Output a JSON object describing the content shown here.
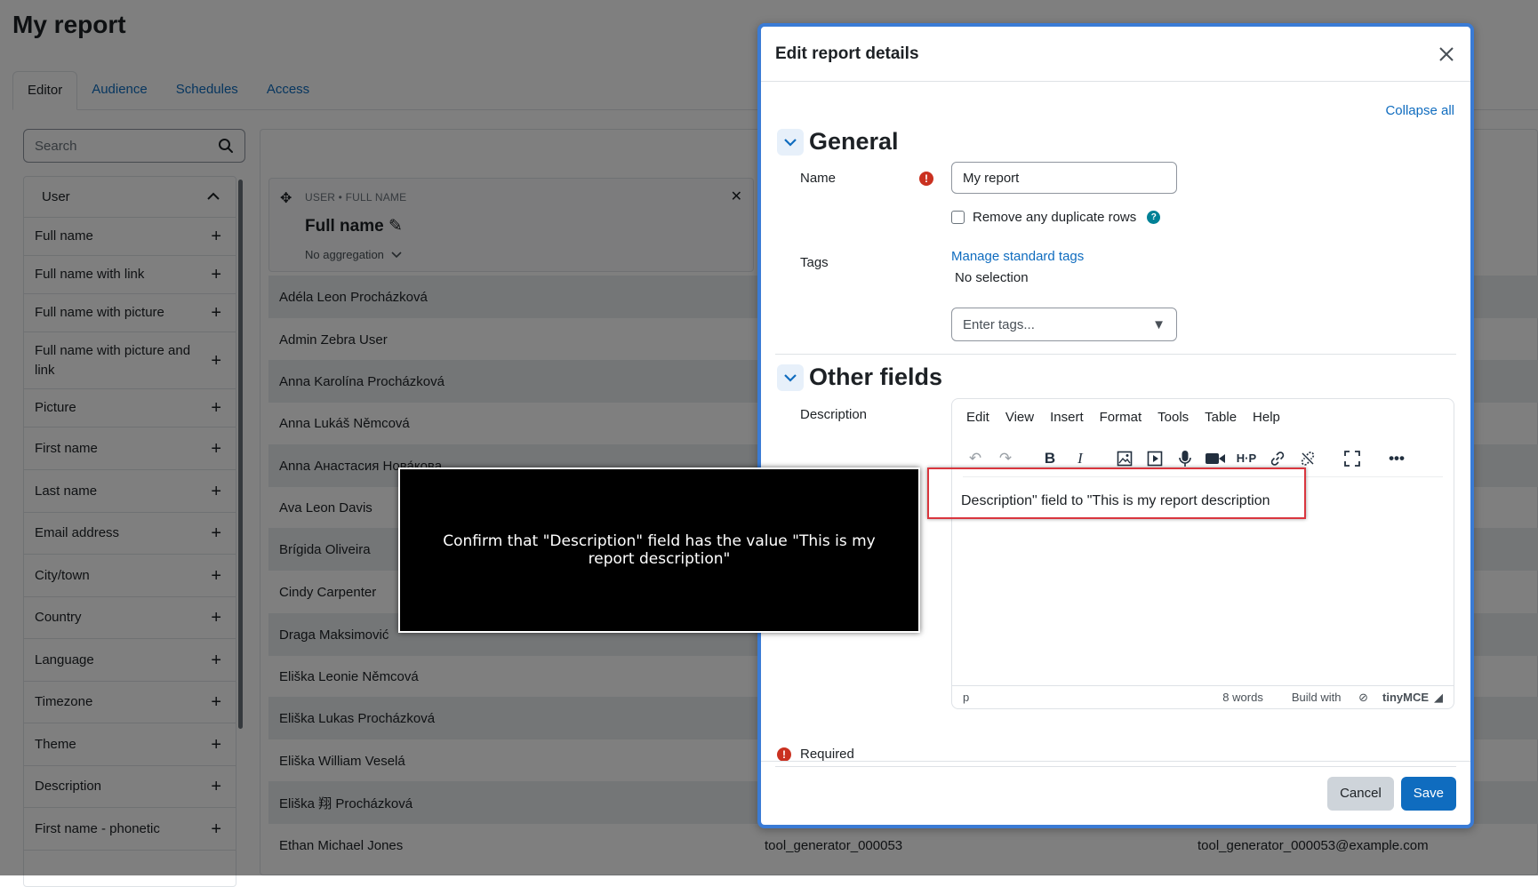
{
  "page": {
    "title": "My report",
    "tabs": [
      {
        "label": "Editor",
        "active": true
      },
      {
        "label": "Audience"
      },
      {
        "label": "Schedules"
      },
      {
        "label": "Access"
      }
    ],
    "search_placeholder": "Search"
  },
  "sidebar": {
    "group": "User",
    "items": [
      "Full name",
      "Full name with link",
      "Full name with picture",
      "Full name with picture and link",
      "Picture",
      "First name",
      "Last name",
      "Email address",
      "City/town",
      "Country",
      "Language",
      "Timezone",
      "Theme",
      "Description",
      "First name - phonetic"
    ]
  },
  "column_card": {
    "meta": "USER • FULL NAME",
    "title": "Full name",
    "aggregation": "No aggregation"
  },
  "rows": [
    {
      "name": "Adéla Leon Procházková"
    },
    {
      "name": "Admin Zebra User"
    },
    {
      "name": "Anna Karolína Procházková"
    },
    {
      "name": "Anna Lukáš Němcová"
    },
    {
      "name": "Anna Анастасия Нова́кова"
    },
    {
      "name": "Ava Leon Davis"
    },
    {
      "name": "Brígida Oliveira"
    },
    {
      "name": "Cindy Carpenter"
    },
    {
      "name": "Draga Maksimović"
    },
    {
      "name": "Eliška Leonie Němcová"
    },
    {
      "name": "Eliška Lukas Procházková"
    },
    {
      "name": "Eliška William Veselá"
    },
    {
      "name": "Eliška 翔 Procházková"
    },
    {
      "name": "Ethan Michael Jones",
      "username": "tool_generator_000053",
      "email": "tool_generator_000053@example.com"
    }
  ],
  "modal": {
    "title": "Edit report details",
    "collapse_all": "Collapse all",
    "general": {
      "title": "General",
      "name_label": "Name",
      "name_value": "My report",
      "duplicate_label": "Remove any duplicate rows",
      "tags_label": "Tags",
      "manage_tags": "Manage standard tags",
      "no_selection": "No selection",
      "tags_placeholder": "Enter tags..."
    },
    "other": {
      "title": "Other fields",
      "description_label": "Description",
      "menu": [
        "Edit",
        "View",
        "Insert",
        "Format",
        "Tools",
        "Table",
        "Help"
      ],
      "content": "Description\" field to \"This is my report description",
      "path": "p",
      "word_count": "8 words",
      "build_with": "Build with",
      "brand": "tinyMCE"
    },
    "required": "Required",
    "cancel": "Cancel",
    "save": "Save"
  },
  "annotation": {
    "caption": "Confirm that \"Description\" field has the value \"This is my report description\"",
    "highlight_color": "#d9363e"
  }
}
